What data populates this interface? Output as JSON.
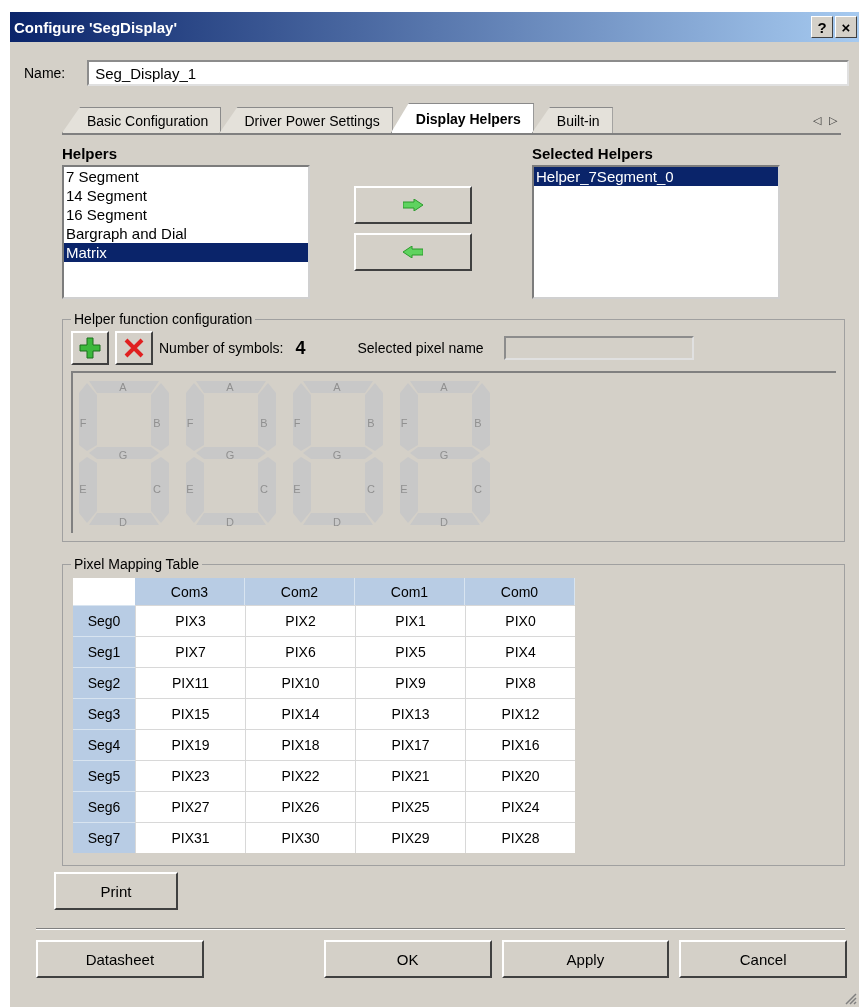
{
  "window": {
    "title": "Configure 'SegDisplay'",
    "controls": [
      "?",
      "×"
    ]
  },
  "name_field": {
    "label": "Name:",
    "value": "Seg_Display_1"
  },
  "tabs": [
    {
      "label": "Basic Configuration",
      "selected": false
    },
    {
      "label": "Driver Power Settings",
      "selected": false
    },
    {
      "label": "Display Helpers",
      "selected": true
    },
    {
      "label": "Built-in",
      "selected": false
    }
  ],
  "tab_scroll": [
    "◁",
    "▷"
  ],
  "helpers": {
    "label": "Helpers",
    "items": [
      {
        "label": "7 Segment",
        "selected": false
      },
      {
        "label": "14 Segment",
        "selected": false
      },
      {
        "label": "16 Segment",
        "selected": false
      },
      {
        "label": "Bargraph and Dial",
        "selected": false
      },
      {
        "label": "Matrix",
        "selected": true
      }
    ]
  },
  "selected_helpers": {
    "label": "Selected Helpers",
    "items": [
      {
        "label": "Helper_7Segment_0",
        "selected": true
      }
    ]
  },
  "helper_config": {
    "title": "Helper function configuration",
    "symbols_label": "Number of symbols:",
    "symbols_count": "4",
    "pixel_name_label": "Selected pixel name",
    "digits": [
      {
        "segments": [
          "A",
          "B",
          "C",
          "D",
          "E",
          "F",
          "G"
        ]
      },
      {
        "segments": [
          "A",
          "B",
          "C",
          "D",
          "E",
          "F",
          "G"
        ]
      },
      {
        "segments": [
          "A",
          "B",
          "C",
          "D",
          "E",
          "F",
          "G"
        ]
      },
      {
        "segments": [
          "A",
          "B",
          "C",
          "D",
          "E",
          "F",
          "G"
        ]
      }
    ]
  },
  "pixel_table": {
    "title": "Pixel Mapping Table",
    "columns": [
      "Com3",
      "Com2",
      "Com1",
      "Com0"
    ],
    "rows": [
      {
        "header": "Seg0",
        "cells": [
          "PIX3",
          "PIX2",
          "PIX1",
          "PIX0"
        ]
      },
      {
        "header": "Seg1",
        "cells": [
          "PIX7",
          "PIX6",
          "PIX5",
          "PIX4"
        ]
      },
      {
        "header": "Seg2",
        "cells": [
          "PIX11",
          "PIX10",
          "PIX9",
          "PIX8"
        ]
      },
      {
        "header": "Seg3",
        "cells": [
          "PIX15",
          "PIX14",
          "PIX13",
          "PIX12"
        ]
      },
      {
        "header": "Seg4",
        "cells": [
          "PIX19",
          "PIX18",
          "PIX17",
          "PIX16"
        ]
      },
      {
        "header": "Seg5",
        "cells": [
          "PIX23",
          "PIX22",
          "PIX21",
          "PIX20"
        ]
      },
      {
        "header": "Seg6",
        "cells": [
          "PIX27",
          "PIX26",
          "PIX25",
          "PIX24"
        ]
      },
      {
        "header": "Seg7",
        "cells": [
          "PIX31",
          "PIX30",
          "PIX29",
          "PIX28"
        ]
      }
    ]
  },
  "print_button": "Print",
  "buttons": [
    "Datasheet",
    "OK",
    "Apply",
    "Cancel"
  ]
}
